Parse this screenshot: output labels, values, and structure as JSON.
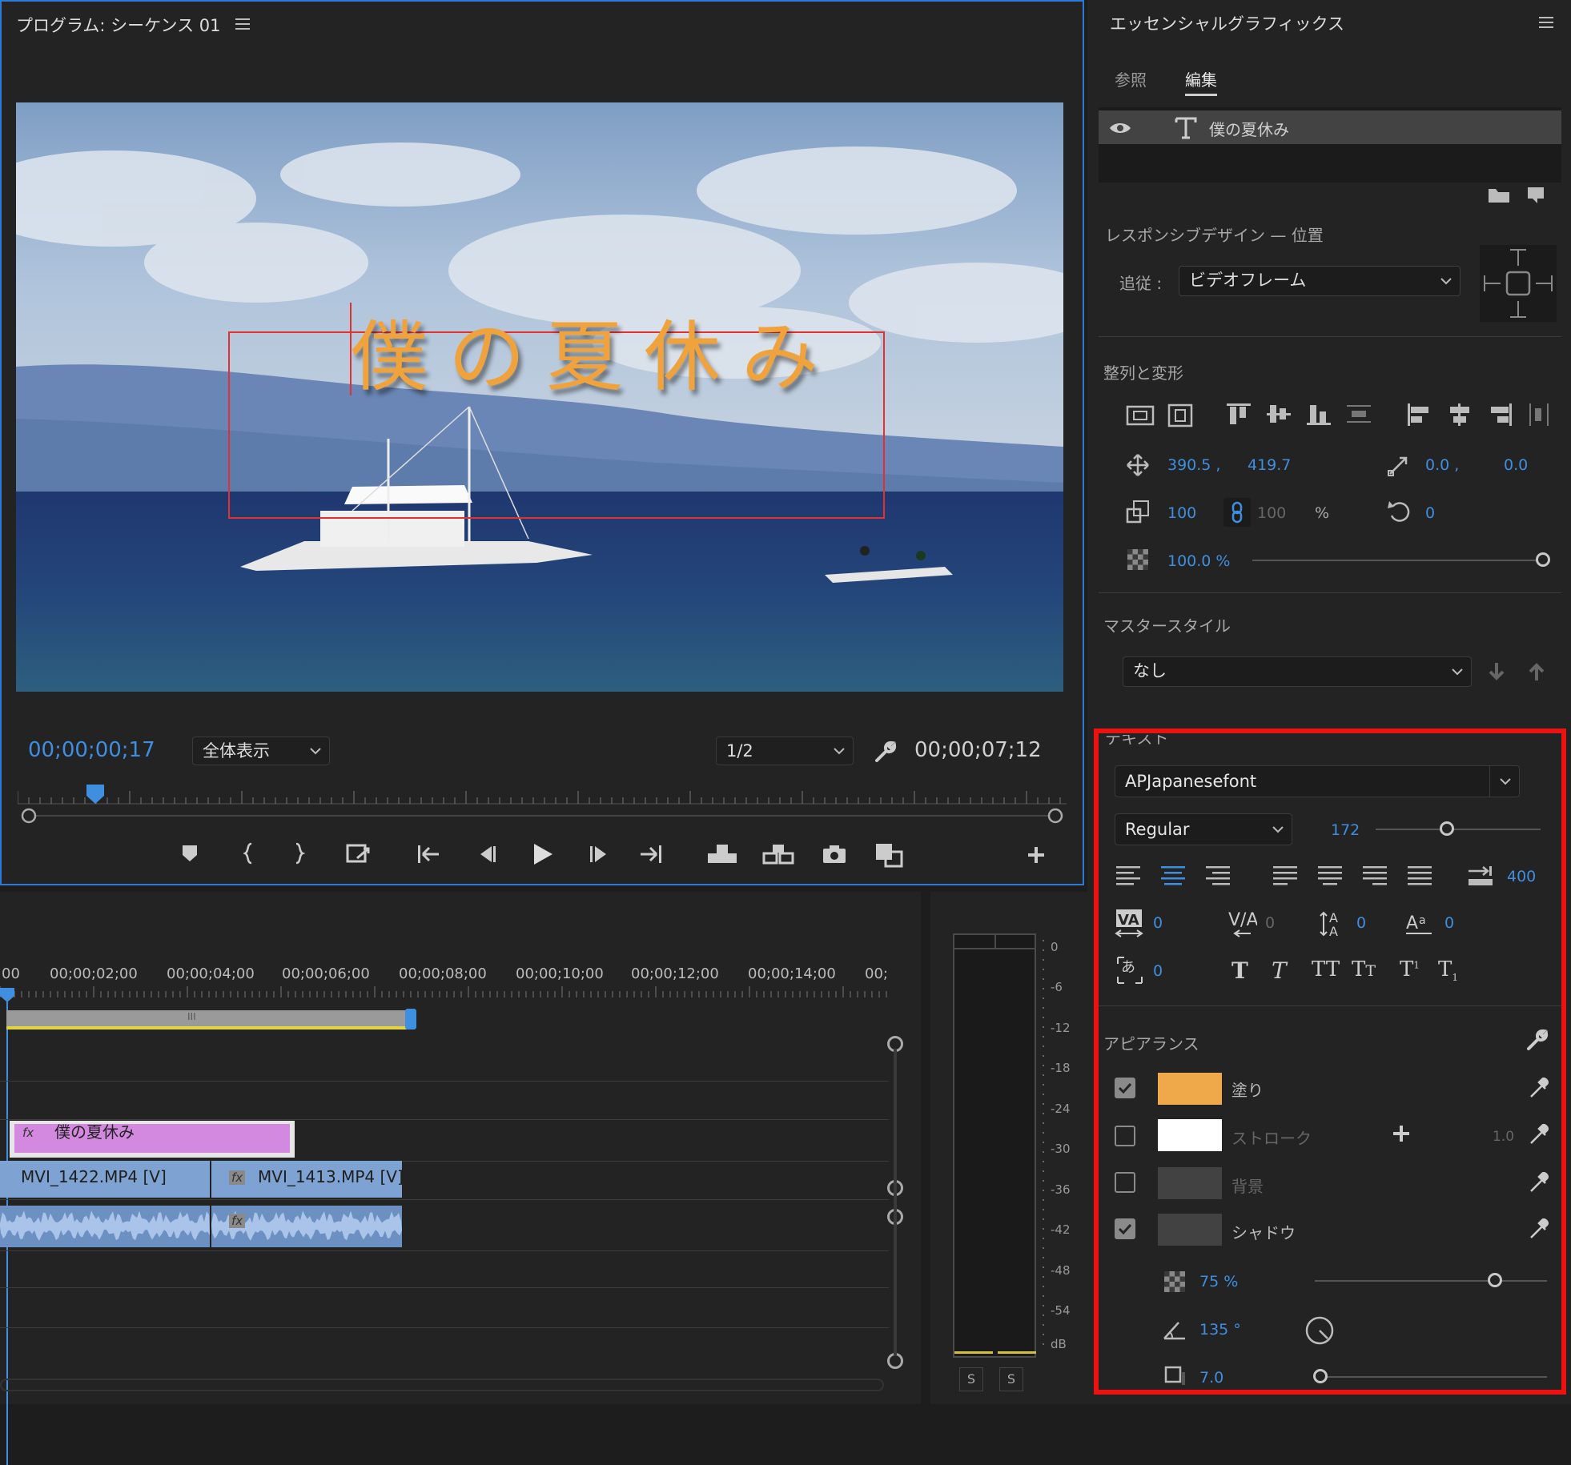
{
  "program": {
    "title": "プログラム: シーケンス 01",
    "menu_icon": "hamburger-icon",
    "timecode_current": "00;00;00;17",
    "timecode_total": "00;00;07;12",
    "zoom_label": "全体表示",
    "resolution_label": "1/2",
    "title_text": "僕の夏休み",
    "title_color": "#f0a33c"
  },
  "essential": {
    "title": "エッセンシャルグラフィックス",
    "tabs": [
      "参照",
      "編集"
    ],
    "layer_name": "僕の夏休み",
    "responsive_heading": "レスポンシブデザイン — 位置",
    "follow_label": "追従 :",
    "follow_value": "ビデオフレーム",
    "align_heading": "整列と変形",
    "pos_x": "390.5 ,",
    "pos_y": "419.7",
    "anchor_x": "0.0 ,",
    "anchor_y": "0.0",
    "scale": "100",
    "scale_h": "100",
    "percent": "%",
    "rotation": "0",
    "opacity": "100.0 %",
    "master_heading": "マスタースタイル",
    "master_value": "なし",
    "text_heading": "テキスト",
    "font": "APJapanesefont",
    "style": "Regular",
    "size": "172",
    "tab_width": "400",
    "tracking": "0",
    "kerning": "0",
    "leading": "0",
    "baseline": "0",
    "tsume": "0",
    "appearance_heading": "アピアランス",
    "fill_label": "塗り",
    "fill_color": "#f0a94a",
    "stroke_label": "ストローク",
    "stroke_width": "1.0",
    "bg_label": "背景",
    "shadow_label": "シャドウ",
    "shadow_opacity": "75 %",
    "shadow_angle": "135 °",
    "shadow_distance": "7.0"
  },
  "timeline": {
    "ruler": [
      "00",
      "00;00;02;00",
      "00;00;04;00",
      "00;00;06;00",
      "00;00;08;00",
      "00;00;10;00",
      "00;00;12;00",
      "00;00;14;00",
      "00;"
    ],
    "clip_title": "僕の夏休み",
    "clip_v1": "MVI_1422.MP4 [V]",
    "clip_v2": "MVI_1413.MP4 [V]",
    "fx": "fx",
    "work_area": "III"
  },
  "meter": {
    "labels": [
      "0",
      "-6",
      "-12",
      "-18",
      "-24",
      "-30",
      "-36",
      "-42",
      "-48",
      "-54",
      "dB"
    ],
    "solo": [
      "S",
      "S"
    ]
  }
}
